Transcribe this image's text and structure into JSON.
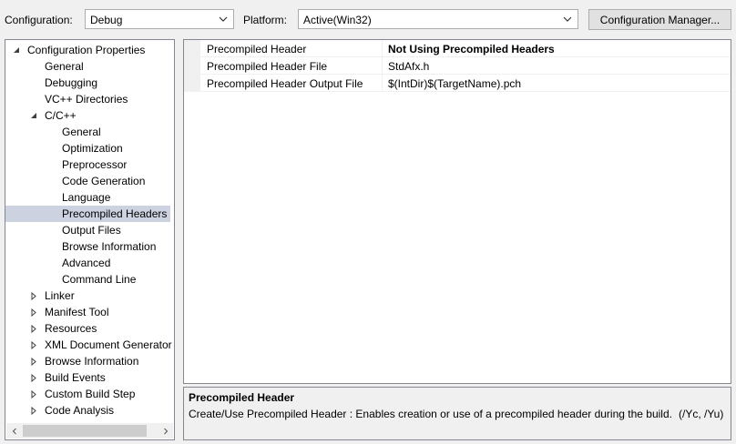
{
  "header": {
    "configuration_label": "Configuration:",
    "configuration_value": "Debug",
    "platform_label": "Platform:",
    "platform_value": "Active(Win32)",
    "config_manager_button": "Configuration Manager..."
  },
  "tree": {
    "items": [
      {
        "label": "Configuration Properties",
        "expander": "expanded"
      },
      {
        "label": "General",
        "expander": "none"
      },
      {
        "label": "Debugging",
        "expander": "none"
      },
      {
        "label": "VC++ Directories",
        "expander": "none"
      },
      {
        "label": "C/C++",
        "expander": "expanded"
      },
      {
        "label": "General",
        "expander": "none"
      },
      {
        "label": "Optimization",
        "expander": "none"
      },
      {
        "label": "Preprocessor",
        "expander": "none"
      },
      {
        "label": "Code Generation",
        "expander": "none"
      },
      {
        "label": "Language",
        "expander": "none"
      },
      {
        "label": "Precompiled Headers",
        "expander": "none",
        "selected": true
      },
      {
        "label": "Output Files",
        "expander": "none"
      },
      {
        "label": "Browse Information",
        "expander": "none"
      },
      {
        "label": "Advanced",
        "expander": "none"
      },
      {
        "label": "Command Line",
        "expander": "none"
      },
      {
        "label": "Linker",
        "expander": "collapsed"
      },
      {
        "label": "Manifest Tool",
        "expander": "collapsed"
      },
      {
        "label": "Resources",
        "expander": "collapsed"
      },
      {
        "label": "XML Document Generator",
        "expander": "collapsed"
      },
      {
        "label": "Browse Information",
        "expander": "collapsed"
      },
      {
        "label": "Build Events",
        "expander": "collapsed"
      },
      {
        "label": "Custom Build Step",
        "expander": "collapsed"
      },
      {
        "label": "Code Analysis",
        "expander": "collapsed"
      }
    ]
  },
  "properties": [
    {
      "name": "Precompiled Header",
      "value": "Not Using Precompiled Headers",
      "bold": true
    },
    {
      "name": "Precompiled Header File",
      "value": "StdAfx.h",
      "bold": false
    },
    {
      "name": "Precompiled Header Output File",
      "value": "$(IntDir)$(TargetName).pch",
      "bold": false
    }
  ],
  "description": {
    "title": "Precompiled Header",
    "text": "Create/Use Precompiled Header : Enables creation or use of a precompiled header during the build.",
    "flags": "(/Yc, /Yu)"
  },
  "colors": {
    "selection": "#cdd2e1",
    "window_bg": "#f0f0f0",
    "border": "#828790"
  },
  "icons": {
    "expanded": "expanded-triangle-icon",
    "collapsed": "collapsed-triangle-icon",
    "dropdown": "chevron-down-icon",
    "scroll_left": "scroll-left-icon",
    "scroll_right": "scroll-right-icon"
  }
}
